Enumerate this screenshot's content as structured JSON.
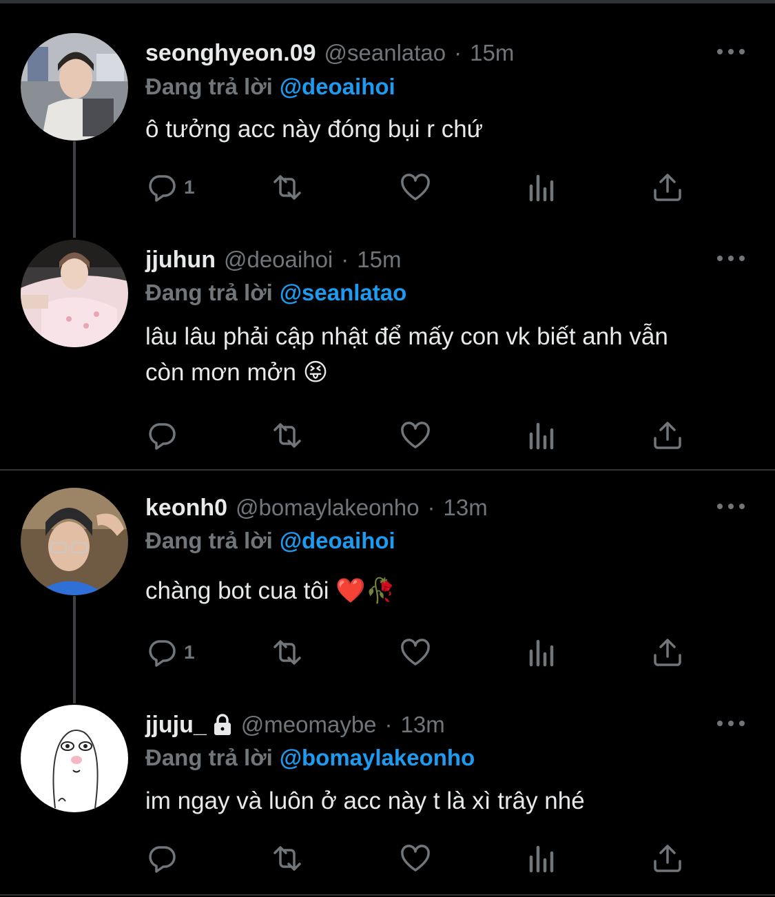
{
  "reply_prefix": "Đang trả lời",
  "tweets": [
    {
      "name": "seonghyeon.09",
      "handle": "@seanlatao",
      "dot": "·",
      "time": "15m",
      "replying_to": "@deoaihoi",
      "text": "ô tưởng acc này đóng bụi r chứ",
      "reply_count": "1",
      "locked": false
    },
    {
      "name": "jjuhun",
      "handle": "@deoaihoi",
      "dot": "·",
      "time": "15m",
      "replying_to": "@seanlatao",
      "text": "lâu lâu phải cập nhật để mấy con vk biết anh vẫn còn mơn mởn",
      "emoji": "😝",
      "reply_count": "",
      "locked": false
    },
    {
      "name": "keonh0",
      "handle": "@bomaylakeonho",
      "dot": "·",
      "time": "13m",
      "replying_to": "@deoaihoi",
      "text": "chàng bot cua tôi",
      "emoji": "❤️🥀",
      "reply_count": "1",
      "locked": false
    },
    {
      "name": "jjuju_",
      "handle": "@meomaybe",
      "dot": "·",
      "time": "13m",
      "replying_to": "@bomaylakeonho",
      "text": "im ngay và luôn ở acc này t là xì trây nhé",
      "reply_count": "",
      "locked": true
    }
  ],
  "icons": {
    "reply": "reply-icon",
    "retweet": "retweet-icon",
    "like": "heart-icon",
    "analytics": "analytics-icon",
    "share": "share-icon",
    "more": "more-icon",
    "lock": "lock-icon"
  },
  "colors": {
    "background": "#000000",
    "text": "#e7e9ea",
    "muted": "#71767b",
    "mention": "#1d9bf0",
    "divider": "#2f3336"
  }
}
